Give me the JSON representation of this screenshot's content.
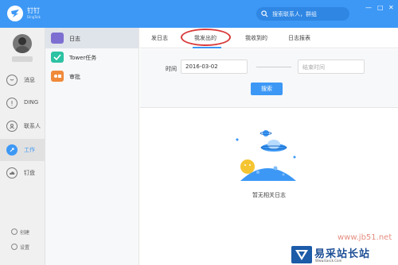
{
  "topbar": {
    "app_name": "钉钉",
    "app_sub": "DingTalk",
    "search_placeholder": "搜索联系人，群组",
    "win_controls": [
      "—",
      "□",
      "✕"
    ]
  },
  "leftnav": {
    "items": [
      {
        "label": "消息",
        "icon": "message-icon"
      },
      {
        "label": "DING",
        "icon": "ding-icon"
      },
      {
        "label": "联系人",
        "icon": "contacts-icon"
      },
      {
        "label": "工作",
        "icon": "work-icon",
        "active": true
      },
      {
        "label": "钉盘",
        "icon": "cloud-drive-icon"
      }
    ],
    "bottom": [
      {
        "label": "创建",
        "icon": "add-icon"
      },
      {
        "label": "设置",
        "icon": "settings-icon"
      }
    ]
  },
  "appcol": {
    "items": [
      {
        "label": "日志",
        "icon": "log-icon",
        "color": "#7d6fd1",
        "active": true
      },
      {
        "label": "Tower任务",
        "icon": "tower-check-icon",
        "color": "#2cc2a3"
      },
      {
        "label": "审批",
        "icon": "approval-icon",
        "color": "#f08a3b"
      }
    ]
  },
  "main": {
    "tabs": [
      "发日志",
      "我发出的",
      "我收到的",
      "日志报表"
    ],
    "active_tab": 1,
    "filter": {
      "time_label": "时间",
      "start_date": "2016-03-02",
      "end_placeholder": "结束时间",
      "search_button": "搜索"
    },
    "empty_text": "暂无相关日志"
  },
  "watermark": {
    "url": "www.jb51.net",
    "site_name": "易采站长站",
    "site_sub": "Www.Easck.Com"
  },
  "colors": {
    "accent": "#3d98f5",
    "highlight": "#d93b3b"
  }
}
